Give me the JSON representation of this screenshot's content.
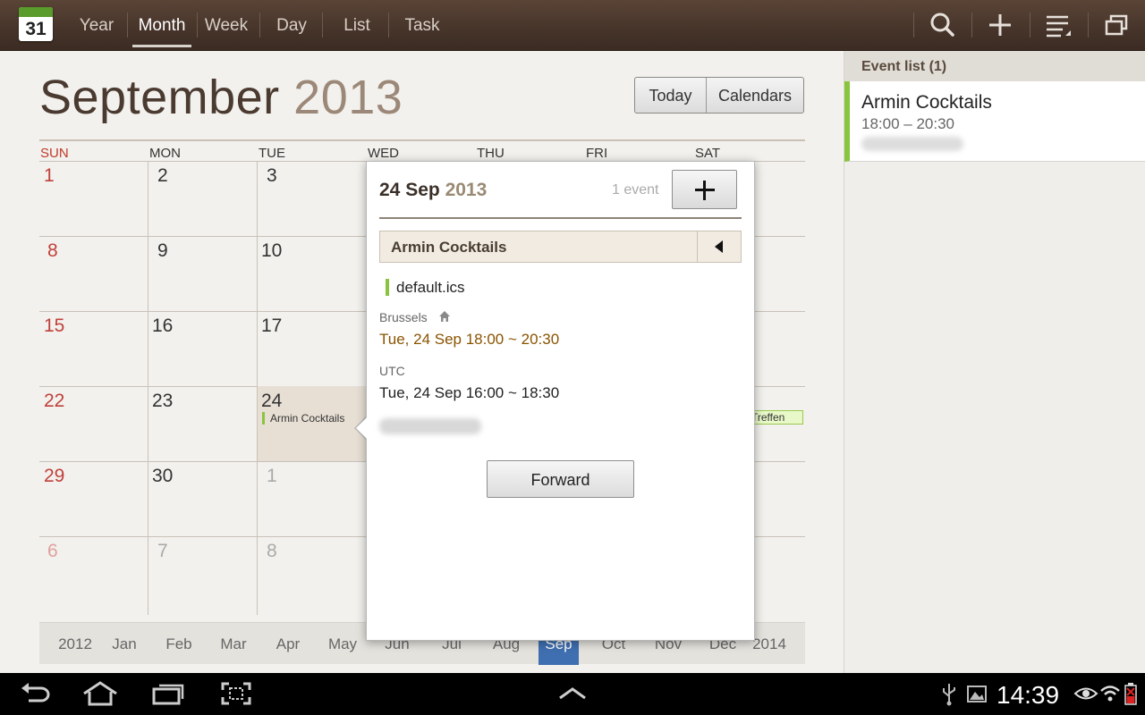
{
  "app": {
    "icon_day": "31"
  },
  "toolbar": {
    "tabs": [
      "Year",
      "Month",
      "Week",
      "Day",
      "List",
      "Task"
    ],
    "active_tab": "Month",
    "icons": [
      "search-icon",
      "add-icon",
      "menu-icon",
      "window-icon"
    ]
  },
  "header": {
    "month": "September",
    "year": "2013",
    "today_label": "Today",
    "calendars_label": "Calendars"
  },
  "calendar": {
    "day_headers": [
      "SUN",
      "MON",
      "TUE",
      "WED",
      "THU",
      "FRI",
      "SAT"
    ],
    "weeks": [
      [
        "1",
        "2",
        "3"
      ],
      [
        "8",
        "9",
        "10"
      ],
      [
        "15",
        "16",
        "17"
      ],
      [
        "22",
        "23",
        "24"
      ],
      [
        "29",
        "30",
        "1"
      ],
      [
        "6",
        "7",
        "8"
      ]
    ],
    "event_on_24": "Armin Cocktails",
    "event_on_sat": "Treffen",
    "accent_color": "#8ac43f",
    "sunday_color": "#c0413b"
  },
  "month_strip": {
    "prev_year": "2012",
    "months": [
      "Jan",
      "Feb",
      "Mar",
      "Apr",
      "May",
      "Jun",
      "Jul",
      "Aug",
      "Sep",
      "Oct",
      "Nov",
      "Dec"
    ],
    "selected": "Sep",
    "next_year": "2014"
  },
  "popup": {
    "date_day": "24 Sep",
    "date_year": "2013",
    "count_label": "1 event",
    "event_title": "Armin Cocktails",
    "calendar_name": "default.ics",
    "tz1_label": "Brussels",
    "tz1_time": "Tue, 24 Sep 18:00 ~ 20:30",
    "tz2_label": "UTC",
    "tz2_time": "Tue, 24 Sep 16:00 ~ 18:30",
    "forward_label": "Forward"
  },
  "event_list": {
    "title": "Event list (1)",
    "items": [
      {
        "title": "Armin Cocktails",
        "time": "18:00 – 20:30"
      }
    ]
  },
  "status_bar": {
    "clock": "14:39",
    "nav_icons": [
      "back-icon",
      "home-icon",
      "recent-apps-icon",
      "screenshot-icon",
      "up-arrow-icon"
    ],
    "status_icons": [
      "usb-icon",
      "gallery-icon",
      "eye-icon",
      "wifi-icon",
      "battery-icon"
    ]
  }
}
